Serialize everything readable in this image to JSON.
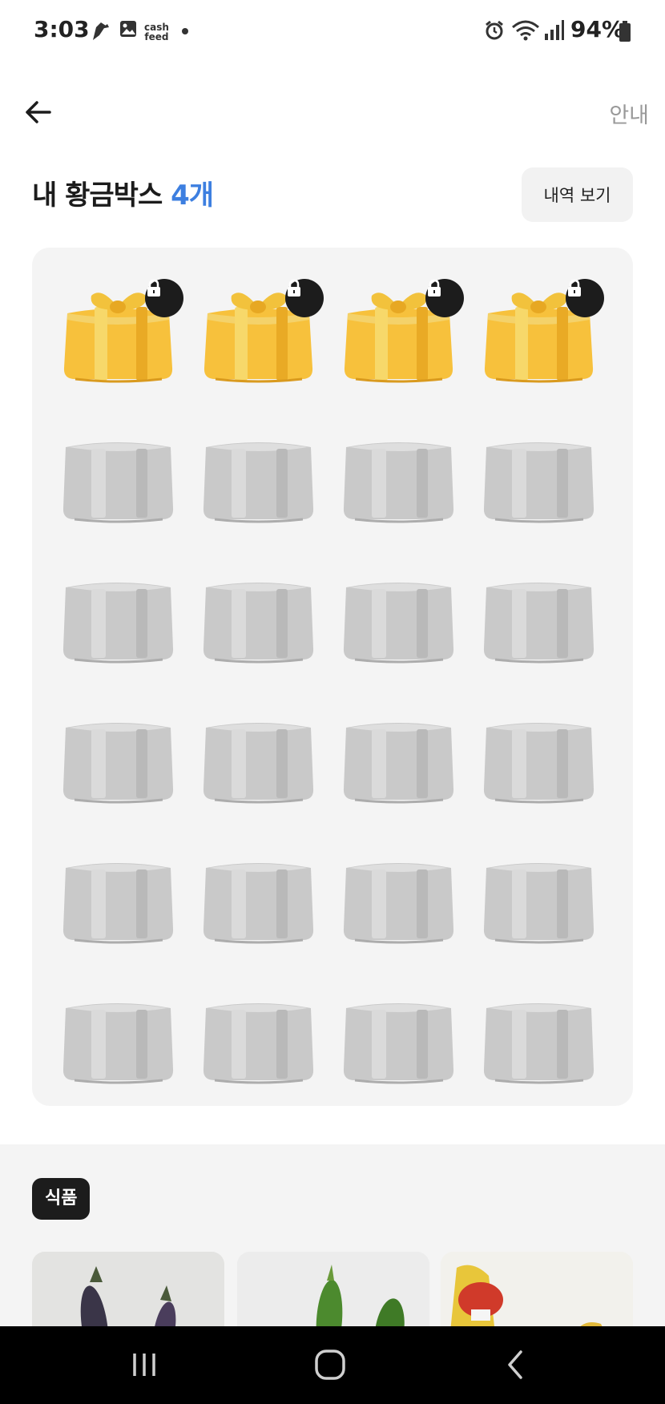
{
  "status_bar": {
    "time": "3:03",
    "app_icon_text": "cash\nfeed",
    "battery": "94%"
  },
  "header": {
    "guide_label": "안내",
    "title_prefix": "내 황금박스",
    "title_count": "4개",
    "history_label": "내역 보기"
  },
  "boxes": {
    "colors": {
      "gold": "#f7c13c",
      "gray": "#c9c9c9",
      "accent": "#3d7fe0"
    },
    "items": [
      {
        "state": "locked-gold"
      },
      {
        "state": "locked-gold"
      },
      {
        "state": "locked-gold"
      },
      {
        "state": "locked-gold"
      },
      {
        "state": "empty"
      },
      {
        "state": "empty"
      },
      {
        "state": "empty"
      },
      {
        "state": "empty"
      },
      {
        "state": "empty"
      },
      {
        "state": "empty"
      },
      {
        "state": "empty"
      },
      {
        "state": "empty"
      },
      {
        "state": "empty"
      },
      {
        "state": "empty"
      },
      {
        "state": "empty"
      },
      {
        "state": "empty"
      },
      {
        "state": "empty"
      },
      {
        "state": "empty"
      },
      {
        "state": "empty"
      },
      {
        "state": "empty"
      },
      {
        "state": "empty"
      },
      {
        "state": "empty"
      },
      {
        "state": "empty"
      },
      {
        "state": "empty"
      }
    ]
  },
  "category": {
    "chip_label": "식품",
    "products": [
      {
        "icon": "eggplant-photo"
      },
      {
        "icon": "cucumber-photo"
      },
      {
        "icon": "banana-photo"
      }
    ]
  },
  "nav": {
    "recents": "recents-icon",
    "home": "home-icon",
    "back": "back-icon"
  }
}
